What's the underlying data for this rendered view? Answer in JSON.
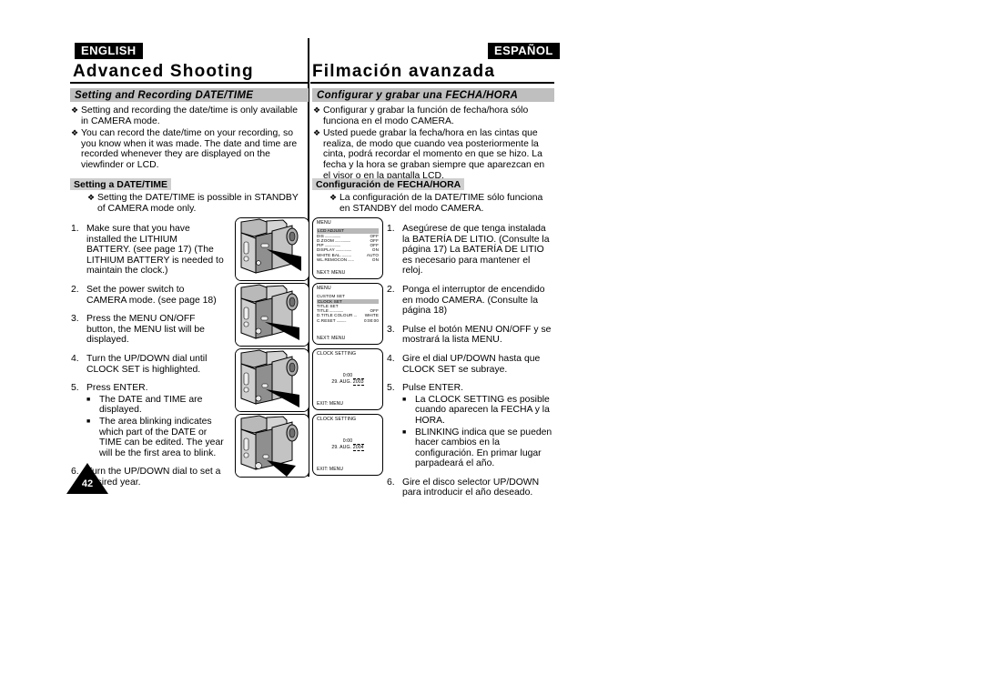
{
  "page": {
    "number": "42"
  },
  "left": {
    "lang_badge": "ENGLISH",
    "chapter_title": "Advanced Shooting",
    "section_bar": "Setting and Recording DATE/TIME",
    "bullets": [
      "Setting and recording the date/time is only available in CAMERA mode.",
      "You can record the date/time on your recording, so you know when it was made. The date and time are recorded whenever they are displayed on the viewfinder or LCD."
    ],
    "sub_label": "Setting a DATE/TIME",
    "sub_bullets": [
      "Setting the DATE/TIME is possible in STANDBY of CAMERA mode only."
    ],
    "steps": [
      {
        "num": "1.",
        "text": "Make sure that you have installed the LITHIUM BATTERY. (see page 17) (The LITHIUM BATTERY is needed to maintain the clock.)",
        "sub": []
      },
      {
        "num": "2.",
        "text": "Set the power switch to CAMERA mode. (see page 18)",
        "sub": []
      },
      {
        "num": "3.",
        "text": "Press the MENU ON/OFF button, the MENU list will be displayed.",
        "sub": []
      },
      {
        "num": "4.",
        "text": "Turn the UP/DOWN dial until CLOCK SET is highlighted.",
        "sub": []
      },
      {
        "num": "5.",
        "text": "Press ENTER.",
        "sub": [
          "The DATE and TIME are displayed.",
          "The area blinking indicates which part of the DATE or TIME can be edited. The year will be the first area to blink."
        ]
      },
      {
        "num": "6.",
        "text": "Turn the UP/DOWN dial to set a desired year.",
        "sub": []
      }
    ]
  },
  "right": {
    "lang_badge": "ESPAÑOL",
    "chapter_title": "Filmación avanzada",
    "section_bar": "Configurar y grabar una FECHA/HORA",
    "bullets": [
      "Configurar y grabar la función de fecha/hora sólo funciona en el modo CAMERA.",
      "Usted puede grabar la fecha/hora en las cintas que realiza, de modo que cuando vea posteriormente la cinta, podrá recordar el momento en que se hizo. La fecha y la hora se graban siempre que aparezcan en el visor o en la pantalla LCD."
    ],
    "sub_label": "Configuración de FECHA/HORA",
    "sub_bullets": [
      "La configuración de la DATE/TIME sólo funciona en STANDBY del modo CAMERA."
    ],
    "steps": [
      {
        "num": "1.",
        "text": "Asegúrese de que tenga instalada la BATERÍA DE LITIO. (Consulte la página 17) La BATERÍA DE LITIO es necesario para mantener el reloj.",
        "sub": []
      },
      {
        "num": "2.",
        "text": "Ponga el interruptor de encendido en modo CAMERA. (Consulte la página 18)",
        "sub": []
      },
      {
        "num": "3.",
        "text": "Pulse el botón MENU ON/OFF y se mostrará la lista MENU.",
        "sub": []
      },
      {
        "num": "4.",
        "text": "Gire el dial UP/DOWN hasta que CLOCK SET se subraye.",
        "sub": []
      },
      {
        "num": "5.",
        "text": "Pulse ENTER.",
        "sub": [
          "La CLOCK SETTING es posible cuando aparecen la FECHA y la HORA.",
          "BLINKING indica que se pueden hacer cambios en la configuración. En primar lugar parpadeará el año."
        ]
      },
      {
        "num": "6.",
        "text": "Gire el disco selector UP/DOWN para introducir el año deseado.",
        "sub": []
      }
    ]
  },
  "osd_screens": [
    {
      "title": "MENU",
      "highlight": "LCD ADJUST",
      "rows": [
        {
          "label": "DIS",
          "value": "OFF"
        },
        {
          "label": "D.ZOOM",
          "value": "OFF"
        },
        {
          "label": "PIP",
          "value": "OFF"
        },
        {
          "label": "DISPLAY",
          "value": "ON"
        },
        {
          "label": "WHITE BAL.",
          "value": "AUTO"
        },
        {
          "label": "WL.REMOCON",
          "value": "ON"
        }
      ],
      "footer": "NEXT: MENU"
    },
    {
      "title": "MENU",
      "plain_rows": [
        "CUSTOM SET"
      ],
      "highlight": "CLOCK SET",
      "plain_rows_after": [
        "TITLE SET"
      ],
      "rows": [
        {
          "label": "TITLE",
          "value": "OFF"
        },
        {
          "label": "D.TITLE COLOUR",
          "value": "WHITE"
        },
        {
          "label": "C.RESET",
          "value": "0:00:00"
        }
      ],
      "footer": "NEXT: MENU"
    },
    {
      "title": "CLOCK SETTING",
      "time": "0:00",
      "date_prefix": "29. AUG. ",
      "date_year": "2003",
      "footer": "EXIT: MENU"
    },
    {
      "title": "CLOCK SETTING",
      "time": "0:00",
      "date_prefix": "29. AUG. ",
      "date_year": "2004",
      "footer": "EXIT: MENU"
    }
  ],
  "illustrations": {
    "camera_label": "camcorder-illustration"
  }
}
